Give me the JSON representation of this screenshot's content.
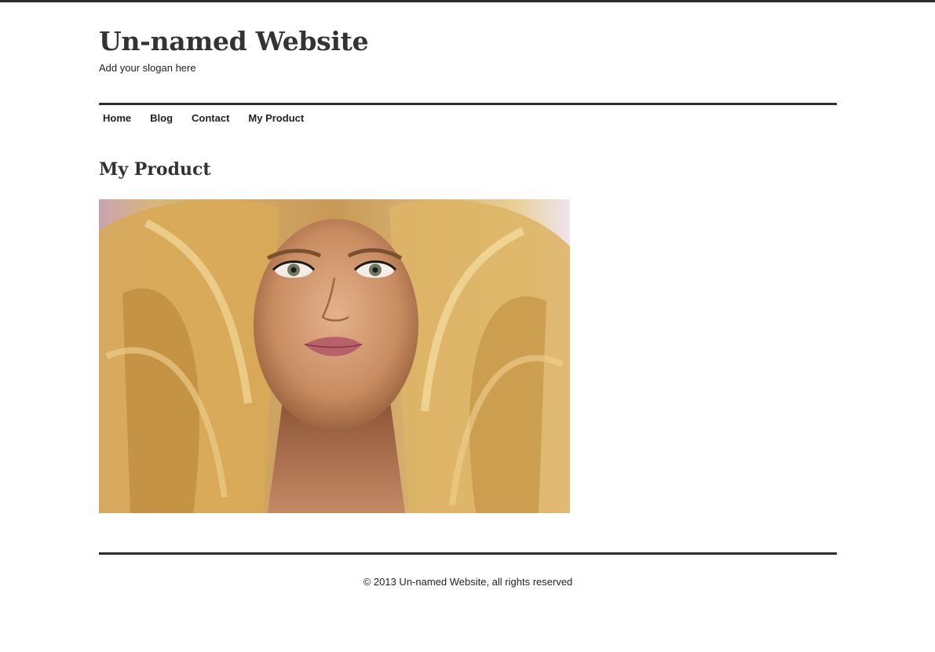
{
  "site": {
    "title": "Un-named Website",
    "slogan": "Add your slogan here"
  },
  "nav": {
    "items": [
      "Home",
      "Blog",
      "Contact",
      "My Product"
    ]
  },
  "main": {
    "heading": "My Product"
  },
  "footer": {
    "copyright": "© 2013 Un-named Website, all rights reserved"
  },
  "colors": {
    "text": "#222222",
    "rule": "#2e2e2e",
    "background": "#ffffff"
  }
}
